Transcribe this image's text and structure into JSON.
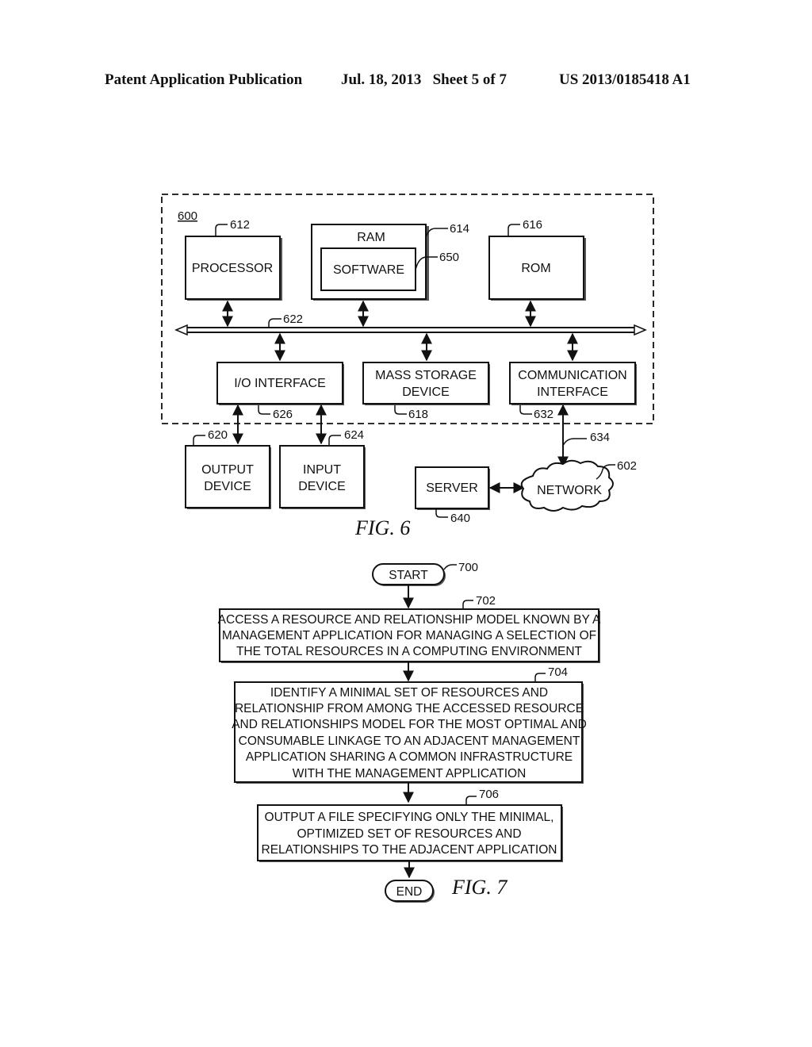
{
  "header": {
    "publication": "Patent Application Publication",
    "date_sheet": "Jul. 18, 2013   Sheet 5 of 7",
    "number": "US 2013/0185418 A1"
  },
  "fig6": {
    "caption": "FIG. 6",
    "system_ref": "600",
    "processor": {
      "label": "PROCESSOR",
      "ref": "612"
    },
    "ram": {
      "label": "RAM",
      "ref": "614"
    },
    "software": {
      "label": "SOFTWARE",
      "ref": "650"
    },
    "rom": {
      "label": "ROM",
      "ref": "616"
    },
    "bus": {
      "ref": "622"
    },
    "io_interface": {
      "label": "I/O INTERFACE",
      "ref": "626"
    },
    "mass_storage": {
      "line1": "MASS STORAGE",
      "line2": "DEVICE",
      "ref": "618"
    },
    "comm_interface": {
      "line1": "COMMUNICATION",
      "line2": "INTERFACE",
      "ref": "632"
    },
    "link_ref": "634",
    "output_device": {
      "line1": "OUTPUT",
      "line2": "DEVICE",
      "ref": "620"
    },
    "input_device": {
      "line1": "INPUT",
      "line2": "DEVICE",
      "ref": "624"
    },
    "server": {
      "label": "SERVER",
      "ref": "640"
    },
    "network": {
      "label": "NETWORK",
      "ref": "602"
    }
  },
  "fig7": {
    "caption": "FIG. 7",
    "start": {
      "label": "START",
      "ref": "700"
    },
    "step702": {
      "ref": "702",
      "lines": [
        "ACCESS A RESOURCE AND RELATIONSHIP MODEL KNOWN BY A",
        "MANAGEMENT APPLICATION FOR MANAGING A SELECTION OF",
        "THE TOTAL RESOURCES IN A COMPUTING ENVIRONMENT"
      ]
    },
    "step704": {
      "ref": "704",
      "lines": [
        "IDENTIFY A MINIMAL SET OF RESOURCES AND",
        "RELATIONSHIP FROM AMONG THE ACCESSED RESOURCE",
        "AND RELATIONSHIPS MODEL FOR THE MOST OPTIMAL AND",
        "CONSUMABLE LINKAGE TO AN ADJACENT MANAGEMENT",
        "APPLICATION SHARING A COMMON INFRASTRUCTURE",
        "WITH THE MANAGEMENT APPLICATION"
      ]
    },
    "step706": {
      "ref": "706",
      "lines": [
        "OUTPUT A FILE SPECIFYING ONLY THE MINIMAL,",
        "OPTIMIZED SET OF RESOURCES AND",
        "RELATIONSHIPS TO THE ADJACENT APPLICATION"
      ]
    },
    "end": {
      "label": "END"
    }
  }
}
